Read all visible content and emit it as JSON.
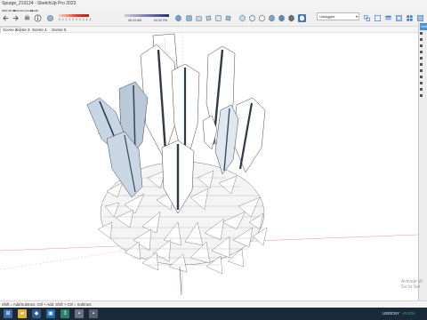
{
  "window": {
    "title": "Spurge_210124 - SketchUp Pro 2023"
  },
  "menu": [
    "Window",
    "Extensions",
    "Help"
  ],
  "toolbar": {
    "ruler_left": "1 1 1 1 1 1 1 1 1 1",
    "time_left": "06:43 AM",
    "time_right": "04:30 PM",
    "layer_value": "Untagged"
  },
  "tabs": [
    "Scene 2",
    "Scene 3",
    "Scene 4",
    "Scene 5"
  ],
  "active_tab_index": 0,
  "right_panel": {
    "header": "Default Tray",
    "items": [
      "",
      "",
      "",
      "",
      "",
      "",
      "",
      "",
      "",
      "",
      ""
    ]
  },
  "status": {
    "text": "Shift = Add/Subtract. Ctrl + Add. Shift + Ctrl = Subtract."
  },
  "watermark": {
    "line1": "Activate W",
    "line2": "Go to Set"
  },
  "taskbar": {
    "currency": "USD/CNY",
    "change": "+0.12%",
    "apps": [
      "file-explorer",
      "sketchup",
      "app-3"
    ]
  },
  "colors": {
    "accent_blue": "#4a90d9",
    "taskbar_bg": "#1b2a3a",
    "petal_blue": "#b9c9d8",
    "change_green": "#22cc66"
  }
}
